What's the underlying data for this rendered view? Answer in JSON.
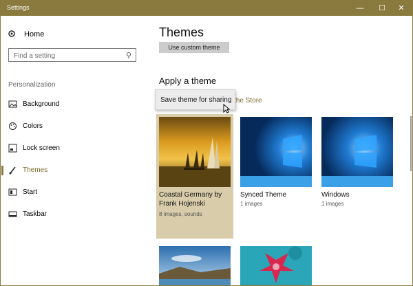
{
  "window": {
    "title": "Settings"
  },
  "sidebar": {
    "home_label": "Home",
    "search_placeholder": "Find a setting",
    "section_label": "Personalization",
    "items": [
      {
        "label": "Background",
        "icon": "picture-icon"
      },
      {
        "label": "Colors",
        "icon": "palette-icon"
      },
      {
        "label": "Lock screen",
        "icon": "lock-screen-icon"
      },
      {
        "label": "Themes",
        "icon": "brush-icon",
        "active": true
      },
      {
        "label": "Start",
        "icon": "start-icon"
      },
      {
        "label": "Taskbar",
        "icon": "taskbar-icon"
      }
    ]
  },
  "content": {
    "page_title": "Themes",
    "custom_theme_button": "Use custom theme",
    "apply_heading": "Apply a theme",
    "store_link": "the Store",
    "context_menu": {
      "item": "Save theme for sharing"
    },
    "themes": [
      {
        "name": "Coastal Germany by Frank Hojenski",
        "meta": "8 images, sounds",
        "selected": true
      },
      {
        "name": "Synced Theme",
        "meta": "1 images"
      },
      {
        "name": "Windows",
        "meta": "1 images"
      }
    ]
  },
  "colors": {
    "accent": "#8a7a3e",
    "selected_tile": "#d8ccaa",
    "link": "#7a6a2a"
  }
}
